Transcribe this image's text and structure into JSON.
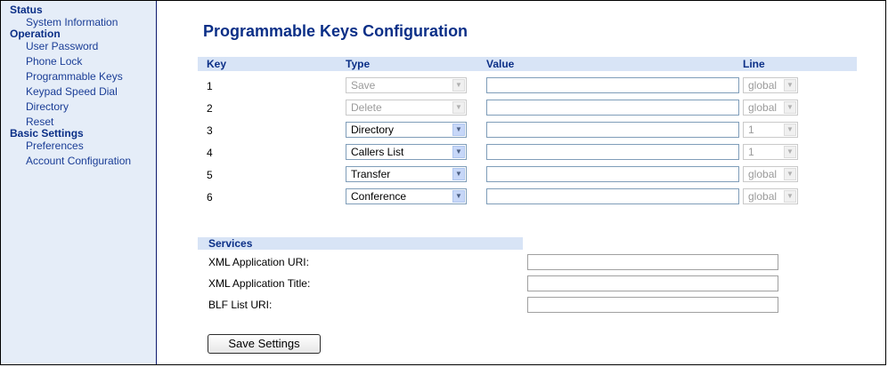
{
  "sidebar": {
    "sections": [
      {
        "heading": "Status",
        "items": [
          "System Information"
        ]
      },
      {
        "heading": "Operation",
        "items": [
          "User Password",
          "Phone Lock",
          "Programmable Keys",
          "Keypad Speed Dial",
          "Directory",
          "Reset"
        ]
      },
      {
        "heading": "Basic Settings",
        "items": [
          "Preferences",
          "Account Configuration"
        ]
      }
    ]
  },
  "page_title": "Programmable Keys Configuration",
  "table": {
    "headers": {
      "key": "Key",
      "type": "Type",
      "value": "Value",
      "line": "Line"
    },
    "rows": [
      {
        "key": "1",
        "type": "Save",
        "type_disabled": true,
        "value": "",
        "line": "global"
      },
      {
        "key": "2",
        "type": "Delete",
        "type_disabled": true,
        "value": "",
        "line": "global"
      },
      {
        "key": "3",
        "type": "Directory",
        "type_disabled": false,
        "value": "",
        "line": "1"
      },
      {
        "key": "4",
        "type": "Callers List",
        "type_disabled": false,
        "value": "",
        "line": "1"
      },
      {
        "key": "5",
        "type": "Transfer",
        "type_disabled": false,
        "value": "",
        "line": "global"
      },
      {
        "key": "6",
        "type": "Conference",
        "type_disabled": false,
        "value": "",
        "line": "global"
      }
    ]
  },
  "services": {
    "heading": "Services",
    "fields": [
      {
        "label": "XML Application URI:",
        "value": ""
      },
      {
        "label": "XML Application Title:",
        "value": ""
      },
      {
        "label": "BLF List URI:",
        "value": ""
      }
    ]
  },
  "save_button": "Save Settings",
  "colors": {
    "nav_bg": "#e5edf8",
    "heading": "#0b2f87",
    "header_bg": "#d8e4f6"
  }
}
